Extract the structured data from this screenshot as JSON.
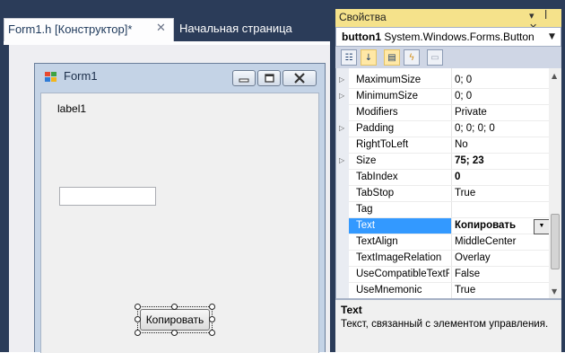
{
  "tabs": [
    {
      "label": "Form1.h [Конструктор]*",
      "active": true
    },
    {
      "label": "Начальная страница",
      "active": false
    }
  ],
  "tab_close_glyph": "✕",
  "form": {
    "title": "Form1",
    "label_text": "label1",
    "textbox_value": "",
    "button_text": "Копировать"
  },
  "properties": {
    "pane_title": "Свойства",
    "pane_tools": "▾ ꟾ ✕",
    "object_name": "button1",
    "object_type": "System.Windows.Forms.Button",
    "rows": [
      {
        "name": "MaximumSize",
        "value": "0; 0",
        "expandable": true,
        "bold": false
      },
      {
        "name": "MinimumSize",
        "value": "0; 0",
        "expandable": true,
        "bold": false
      },
      {
        "name": "Modifiers",
        "value": "Private",
        "expandable": false,
        "bold": false
      },
      {
        "name": "Padding",
        "value": "0; 0; 0; 0",
        "expandable": true,
        "bold": false
      },
      {
        "name": "RightToLeft",
        "value": "No",
        "expandable": false,
        "bold": false
      },
      {
        "name": "Size",
        "value": "75; 23",
        "expandable": true,
        "bold": true
      },
      {
        "name": "TabIndex",
        "value": "0",
        "expandable": false,
        "bold": true
      },
      {
        "name": "TabStop",
        "value": "True",
        "expandable": false,
        "bold": false
      },
      {
        "name": "Tag",
        "value": "",
        "expandable": false,
        "bold": false
      },
      {
        "name": "Text",
        "value": "Копировать",
        "expandable": false,
        "bold": true,
        "selected": true
      },
      {
        "name": "TextAlign",
        "value": "MiddleCenter",
        "expandable": false,
        "bold": false
      },
      {
        "name": "TextImageRelation",
        "value": "Overlay",
        "expandable": false,
        "bold": false
      },
      {
        "name": "UseCompatibleTextR",
        "value": "False",
        "expandable": false,
        "bold": false
      },
      {
        "name": "UseMnemonic",
        "value": "True",
        "expandable": false,
        "bold": false
      }
    ],
    "description_title": "Text",
    "description_text": "Текст, связанный с элементом управления."
  },
  "colors": {
    "frame": "#2b3c59",
    "selected_row": "#3399ff",
    "pane_title_bg": "#f5e28b"
  }
}
